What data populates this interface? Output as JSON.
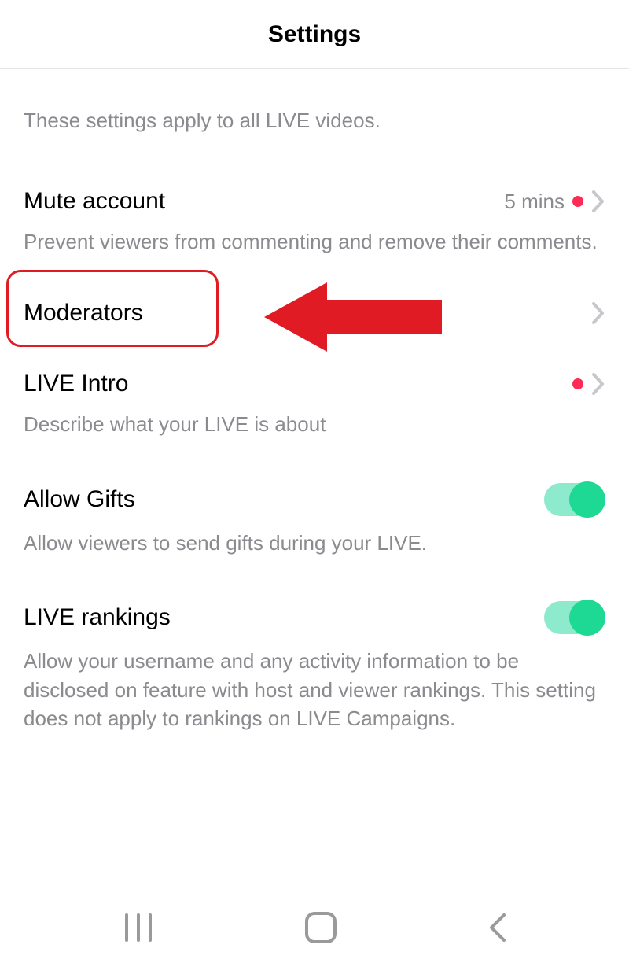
{
  "header": {
    "title": "Settings"
  },
  "intro": "These settings apply to all LIVE videos.",
  "settings": {
    "mute": {
      "title": "Mute account",
      "value": "5 mins",
      "desc": "Prevent viewers from commenting and remove their comments."
    },
    "moderators": {
      "title": "Moderators"
    },
    "liveIntro": {
      "title": "LIVE Intro",
      "desc": "Describe what your LIVE is about"
    },
    "allowGifts": {
      "title": "Allow Gifts",
      "desc": "Allow viewers to send gifts during your LIVE."
    },
    "liveRankings": {
      "title": "LIVE rankings",
      "desc": "Allow your username and any activity information to be disclosed on feature with host and viewer rankings. This setting does not apply to rankings on LIVE Campaigns."
    }
  },
  "annotation": {
    "highlightColor": "#e01b24",
    "arrowColor": "#e01b24"
  },
  "colors": {
    "accentDot": "#fe2c55",
    "toggleTrack": "#8deacc",
    "toggleKnob": "#1ed994"
  }
}
